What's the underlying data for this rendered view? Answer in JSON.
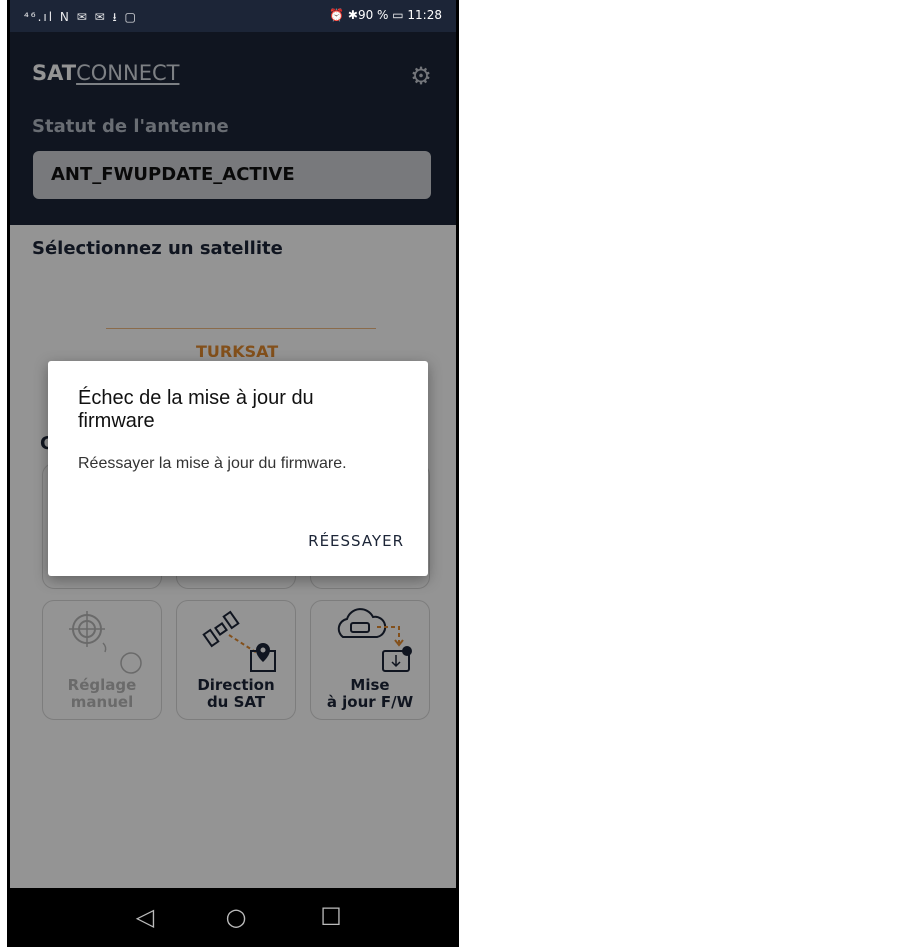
{
  "status_bar": {
    "left_icons": "⁴⁶.ıl N ✉ ✉ ⭳ ▢",
    "right": "⏰ ✱90 % ▭ 11:28"
  },
  "header": {
    "logo_sat": "SAT",
    "logo_connect": "CONNECT",
    "settings_icon": "gear-icon",
    "antenna_title": "Statut de l'antenne",
    "antenna_status": "ANT_FWUPDATE_ACTIVE"
  },
  "content": {
    "select_title": "Sélectionnez un satellite",
    "satellite_name": "TURKSAT",
    "section_letter": "C",
    "tiles": [
      {
        "label_line1": "Réglage",
        "label_line2": "manuel",
        "icon": "manual-tune-icon",
        "enabled": false
      },
      {
        "label_line1": "Direction",
        "label_line2": "du SAT",
        "icon": "satellite-direction-icon",
        "enabled": true
      },
      {
        "label_line1": "Mise",
        "label_line2": "à jour F/W",
        "icon": "cloud-firmware-icon",
        "enabled": true
      }
    ]
  },
  "dialog": {
    "title": "Échec de la mise à jour du firmware",
    "message": "Réessayer la mise à jour du firmware.",
    "button": "RÉESSAYER"
  },
  "navbar": {
    "back": "◁",
    "home": "○",
    "recents": "☐"
  },
  "colors": {
    "header_bg": "#1c2537",
    "accent": "#e28b2f",
    "antenna_box": "#cfd1d6"
  }
}
